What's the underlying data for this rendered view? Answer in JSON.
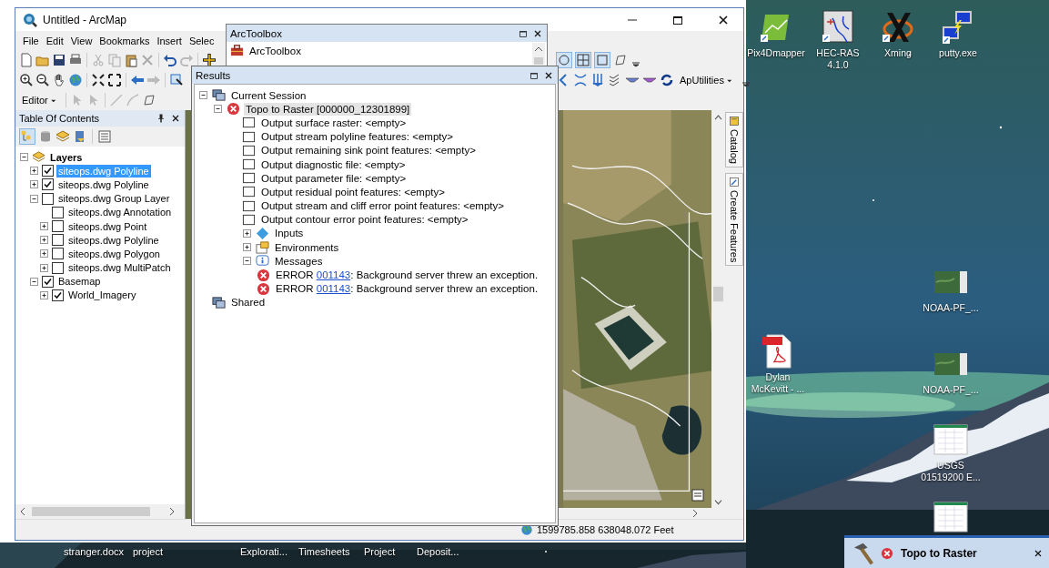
{
  "desktop_icons": [
    {
      "label": "Pix4Dmapper",
      "kind": "pix4d"
    },
    {
      "label": "HEC-RAS 4.1.0",
      "kind": "hecras"
    },
    {
      "label": "Xming",
      "kind": "xming"
    },
    {
      "label": "putty.exe",
      "kind": "putty"
    },
    {
      "label": "NOAA-PF_...",
      "kind": "map_image"
    },
    {
      "label": "Dylan McKevitt - ...",
      "kind": "pdf"
    },
    {
      "label": "NOAA-PF_...",
      "kind": "map_image"
    },
    {
      "label": "USGS 01519200 E...",
      "kind": "spreadsheet"
    },
    {
      "kind": "spreadsheet"
    }
  ],
  "background_labels": [
    "stranger.docx",
    "project",
    "Explorati...",
    "Timesheets",
    "Project",
    "Deposit..."
  ],
  "arcmap": {
    "title": "Untitled - ArcMap",
    "menu": [
      "File",
      "Edit",
      "View",
      "Bookmarks",
      "Insert",
      "Selec"
    ],
    "editor_menu": "Editor",
    "utilities_menu": "ApUtilities",
    "toc": {
      "title": "Table Of Contents",
      "layers": [
        {
          "label": "Layers",
          "kind": "dataframe",
          "expanded": true,
          "selected": false,
          "children": [
            {
              "label": "siteops.dwg Polyline",
              "expanded": false,
              "checked": true,
              "selected": true
            },
            {
              "label": "siteops.dwg Polyline",
              "expanded": false,
              "checked": true,
              "selected": false
            },
            {
              "label": "siteops.dwg Group Layer",
              "expanded": true,
              "checked": false,
              "selected": false,
              "children": [
                {
                  "label": "siteops.dwg Annotation",
                  "checked": false,
                  "selected": false
                },
                {
                  "label": "siteops.dwg Point",
                  "expanded": false,
                  "checked": false,
                  "selected": false
                },
                {
                  "label": "siteops.dwg Polyline",
                  "expanded": false,
                  "checked": false,
                  "selected": false
                },
                {
                  "label": "siteops.dwg Polygon",
                  "expanded": false,
                  "checked": false,
                  "selected": false
                },
                {
                  "label": "siteops.dwg MultiPatch",
                  "expanded": false,
                  "checked": false,
                  "selected": false
                }
              ]
            },
            {
              "label": "Basemap",
              "expanded": true,
              "checked": true,
              "selected": false,
              "children": [
                {
                  "label": "World_Imagery",
                  "expanded": false,
                  "checked": true,
                  "selected": false
                }
              ]
            }
          ]
        }
      ]
    },
    "side_tabs": [
      "Catalog",
      "Create Features"
    ],
    "status": "1599785.858  638048.072 Feet"
  },
  "arctoolbox": {
    "title": "ArcToolbox",
    "items": [
      "ArcToolbox"
    ]
  },
  "results": {
    "title": "Results",
    "tree": [
      {
        "label": "Current Session",
        "kind": "session",
        "expanded": true,
        "selected": false,
        "children": [
          {
            "label": "Topo to Raster [000000_12301899]",
            "kind": "failed_tool",
            "expanded": true,
            "selected": true,
            "children": [
              {
                "label": "Output surface raster: <empty>",
                "kind": "output",
                "selected": false
              },
              {
                "label": "Output stream polyline features: <empty>",
                "kind": "output",
                "selected": false
              },
              {
                "label": "Output remaining sink point features: <empty>",
                "kind": "output",
                "selected": false
              },
              {
                "label": "Output diagnostic file: <empty>",
                "kind": "output",
                "selected": false
              },
              {
                "label": "Output parameter file: <empty>",
                "kind": "output",
                "selected": false
              },
              {
                "label": "Output residual point features: <empty>",
                "kind": "output",
                "selected": false
              },
              {
                "label": "Output stream and cliff error point features: <empty>",
                "kind": "output",
                "selected": false
              },
              {
                "label": "Output contour error point features: <empty>",
                "kind": "output",
                "selected": false
              },
              {
                "label": "Inputs",
                "kind": "inputs",
                "expanded": false,
                "selected": false
              },
              {
                "label": "Environments",
                "kind": "environments",
                "expanded": false,
                "selected": false
              },
              {
                "label": "Messages",
                "kind": "messages",
                "expanded": true,
                "selected": false,
                "children": [
                  {
                    "label": "ERROR ",
                    "code": "001143",
                    "text": ": Background server threw an exception.",
                    "kind": "error",
                    "selected": false
                  },
                  {
                    "label": "ERROR ",
                    "code": "001143",
                    "text": ": Background server threw an exception.",
                    "kind": "error",
                    "selected": false
                  }
                ]
              }
            ]
          }
        ]
      },
      {
        "label": "Shared",
        "kind": "session",
        "selected": false
      }
    ]
  },
  "notification": {
    "title": "Topo to Raster"
  }
}
